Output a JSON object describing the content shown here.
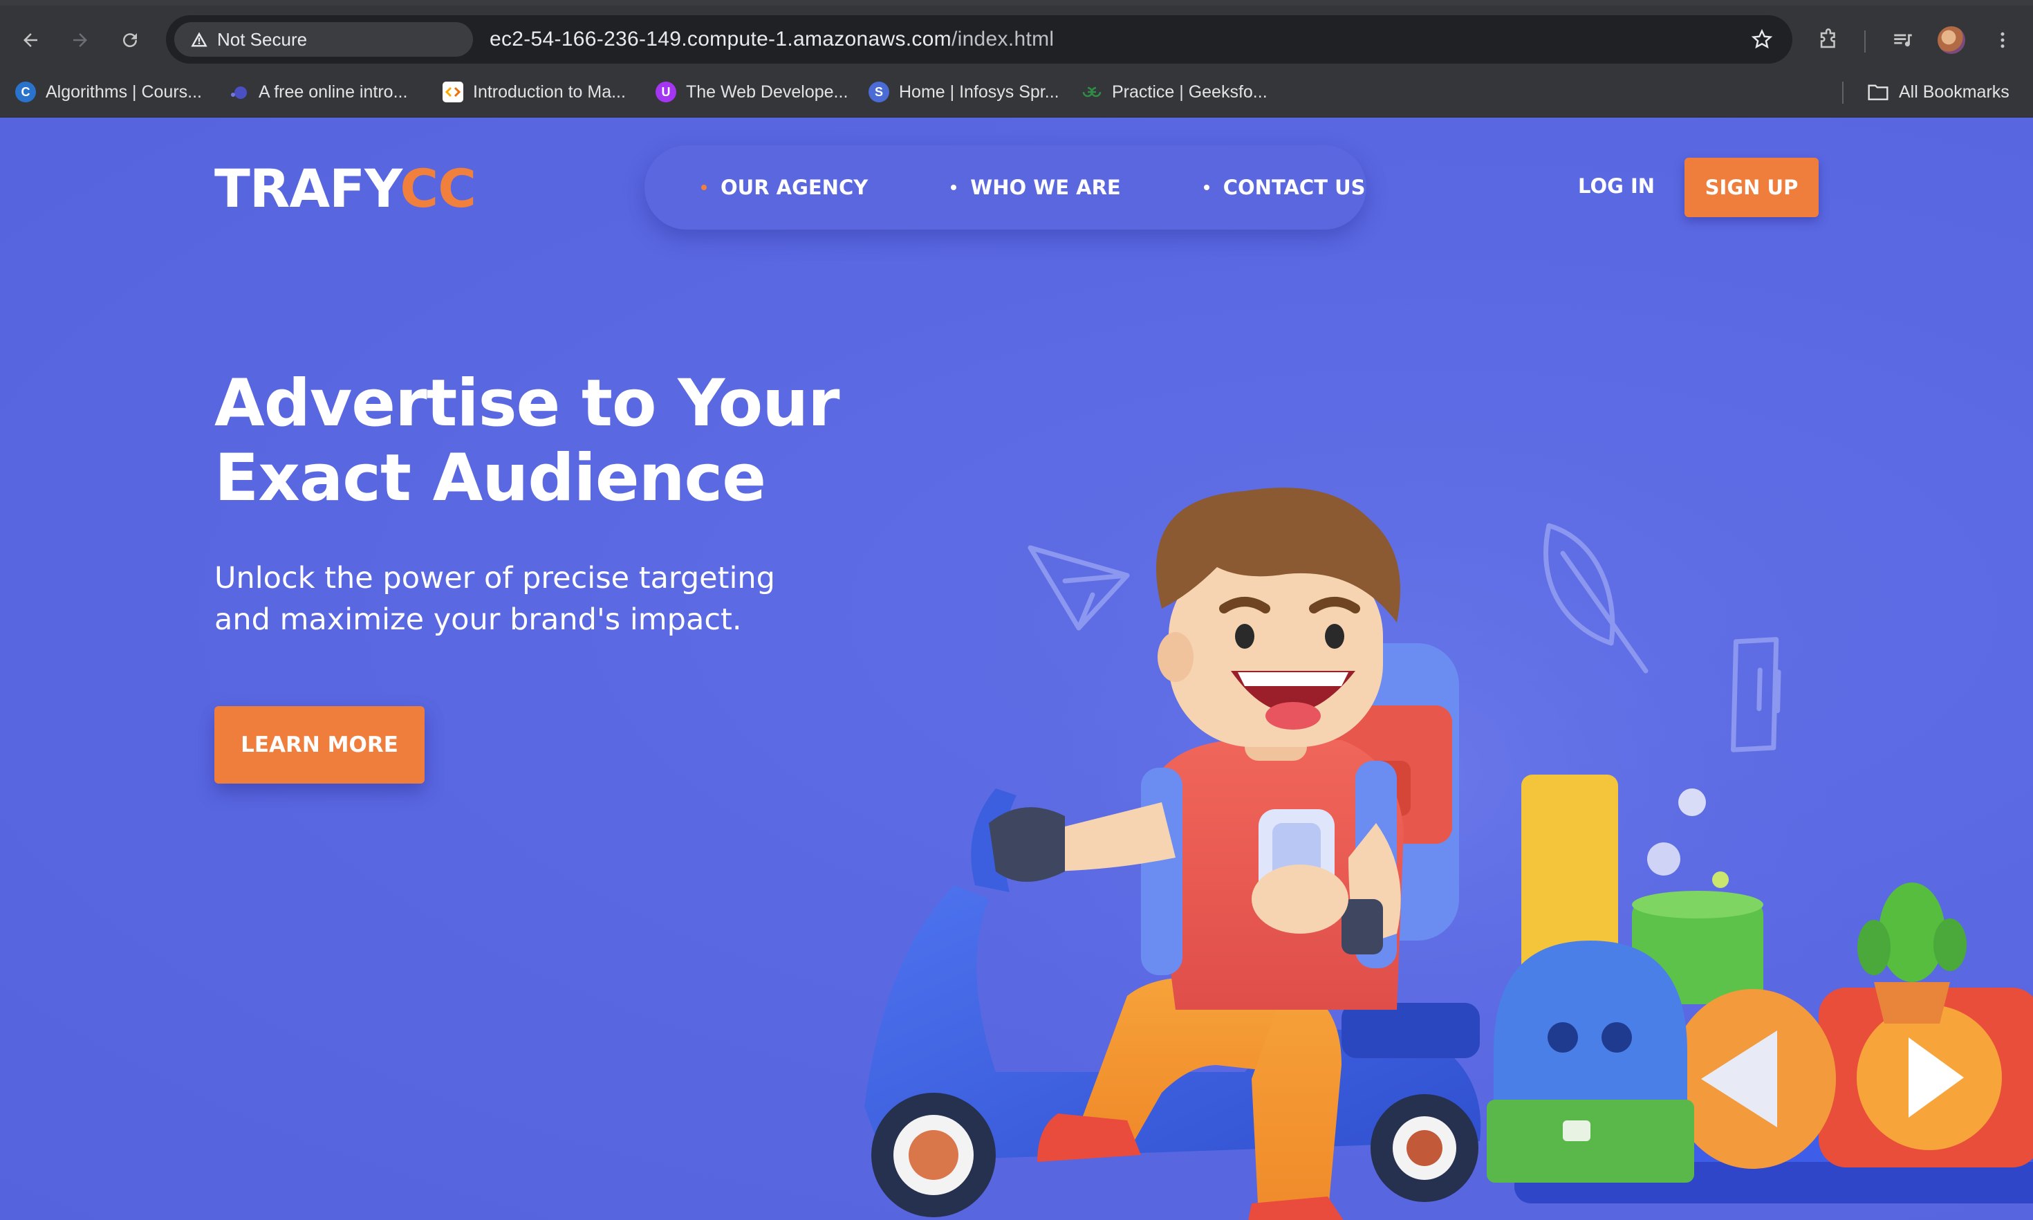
{
  "browser": {
    "security_label": "Not Secure",
    "url_host": "ec2-54-166-236-149.compute-1.amazonaws.com",
    "url_path": "/index.html",
    "bookmarks": [
      {
        "label": "Algorithms | Cours...",
        "icon": "coursera-icon",
        "color": "#2a73cc"
      },
      {
        "label": "A free online intro...",
        "icon": "dot-icon",
        "color": "#4b4fc4"
      },
      {
        "label": "Introduction to Ma...",
        "icon": "colab-icon",
        "color": "#ffffff"
      },
      {
        "label": "The Web Develope...",
        "icon": "udemy-icon",
        "color": "#a435f0"
      },
      {
        "label": "Home | Infosys Spr...",
        "icon": "infosys-icon",
        "color": "#4a6cd4"
      },
      {
        "label": "Practice | Geeksfo...",
        "icon": "gfg-icon",
        "color": "#2f8d46"
      }
    ],
    "all_bookmarks": "All Bookmarks"
  },
  "site": {
    "logo_part1": "TRAFY",
    "logo_part2": "CC",
    "nav": [
      "OUR AGENCY",
      "WHO WE ARE",
      "CONTACT US"
    ],
    "login": "LOG IN",
    "signup": "SIGN UP",
    "hero_title_line1": "Advertise to Your",
    "hero_title_line2": "Exact Audience",
    "hero_sub_line1": "Unlock the power of precise targeting",
    "hero_sub_line2": "and maximize your brand's impact.",
    "cta": "LEARN MORE",
    "colors": {
      "primary": "#5a68e2",
      "accent": "#ef7d3c"
    }
  }
}
